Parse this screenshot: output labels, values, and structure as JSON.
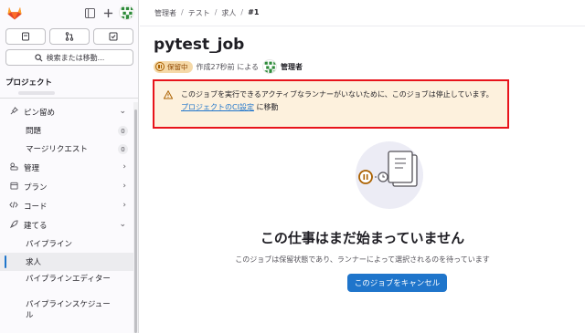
{
  "sidebar": {
    "search_label": "検索または移動...",
    "section_title": "プロジェクト",
    "nav": [
      {
        "icon": "pin-icon",
        "label": "ピン留め",
        "chevron": "⌄"
      },
      {
        "label": "問題",
        "badge": "0"
      },
      {
        "label": "マージリクエスト",
        "badge": "0"
      },
      {
        "icon": "manage-icon",
        "label": "管理",
        "chevron": "›"
      },
      {
        "icon": "plan-icon",
        "label": "プラン",
        "chevron": "›"
      },
      {
        "icon": "code-icon",
        "label": "コード",
        "chevron": "›"
      },
      {
        "icon": "rocket-icon",
        "label": "建てる",
        "chevron": "⌄"
      },
      {
        "label": "パイプライン"
      },
      {
        "label": "求人"
      },
      {
        "label": "パイプラインエディター"
      },
      {
        "label": "パイプラインスケジュール"
      }
    ]
  },
  "breadcrumb": {
    "items": [
      "管理者",
      "テスト",
      "求人",
      "#1"
    ],
    "separators": [
      "/",
      "/",
      "/"
    ]
  },
  "job": {
    "title": "pytest_job",
    "status": "保留中",
    "created": "作成27秒前 による",
    "user": "管理者"
  },
  "alert": {
    "message": "このジョブを実行できるアクティブなランナーがいないために、このジョブは停止しています。",
    "link_text": "プロジェクトのCI設定",
    "link_suffix": " に移動"
  },
  "empty_state": {
    "title": "この仕事はまだ始まっていません",
    "description": "このジョブは保留状態であり、ランナーによって選択されるのを待っています",
    "cancel_label": "このジョブをキャンセル"
  },
  "colors": {
    "primary": "#1f75cb",
    "warning_bg": "#fdf1dd",
    "pending": "#ab6100",
    "highlight_frame": "#e8141b"
  }
}
